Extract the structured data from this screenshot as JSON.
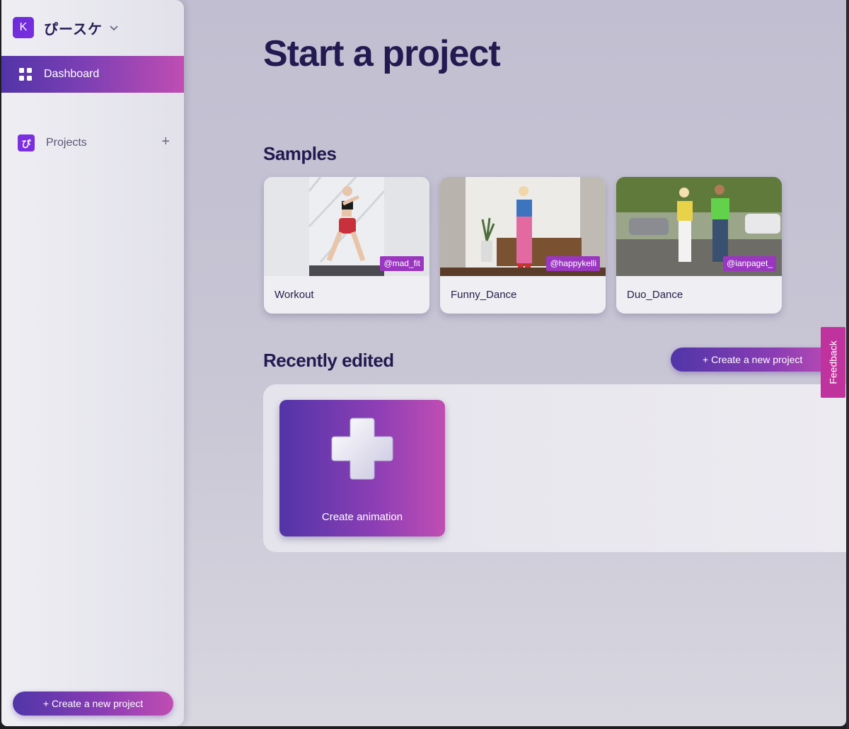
{
  "sidebar": {
    "workspace": {
      "avatar_letter": "K",
      "name": "ぴースケ"
    },
    "nav_dashboard": "Dashboard",
    "nav_projects": "Projects",
    "projects_icon_char": "ぴ",
    "projects_add": "+",
    "create_button": "+ Create a new project"
  },
  "main": {
    "title": "Start a project",
    "samples_title": "Samples",
    "samples": [
      {
        "name": "Workout",
        "credit": "@mad_fit"
      },
      {
        "name": "Funny_Dance",
        "credit": "@happykelli"
      },
      {
        "name": "Duo_Dance",
        "credit": "@ianpaget_"
      }
    ],
    "recent_title": "Recently edited",
    "recent_create_button": "+ Create a new project",
    "create_animation_label": "Create animation"
  },
  "feedback_label": "Feedback",
  "colors": {
    "accent_start": "#5036a8",
    "accent_end": "#c04db3",
    "title_text": "#221a50",
    "workspace_avatar": "#7b2fe0",
    "feedback_tab": "#c0339f"
  }
}
